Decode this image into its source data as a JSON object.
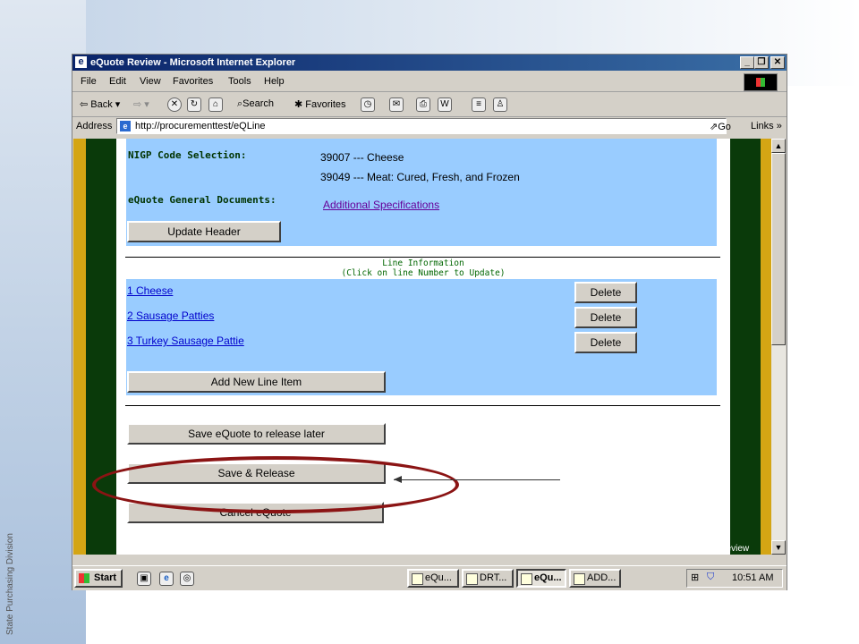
{
  "window": {
    "title": "eQuote Review - Microsoft Internet Explorer"
  },
  "menu": [
    "File",
    "Edit",
    "View",
    "Favorites",
    "Tools",
    "Help"
  ],
  "toolbar": {
    "back": "Back",
    "search": "Search",
    "favorites": "Favorites"
  },
  "address": {
    "label": "Address",
    "url": "http://procurementtest/eQLine",
    "go": "Go",
    "links": "Links"
  },
  "header": {
    "nigp_label": "NIGP Code Selection:",
    "nigp_codes": [
      "39007 --- Cheese",
      "39049 --- Meat: Cured, Fresh, and Frozen"
    ],
    "docs_label": "eQuote General Documents:",
    "docs_link": "Additional Specifications",
    "update_button": "Update Header"
  },
  "line_info": {
    "title": "Line Information",
    "hint": "(Click on line Number to Update)"
  },
  "line_items": [
    {
      "label": "1 Cheese",
      "delete": "Delete"
    },
    {
      "label": "2 Sausage Patties",
      "delete": "Delete"
    },
    {
      "label": "3 Turkey Sausage Pattie",
      "delete": "Delete"
    }
  ],
  "add_line_button": "Add New Line Item",
  "actions": {
    "save_later": "Save eQuote to release later",
    "save_release": "Save & Release",
    "cancel": "Cancel eQuote"
  },
  "frame_label": "EQ review",
  "taskbar": {
    "start": "Start",
    "tasks": [
      {
        "label": "eQu...",
        "active": false
      },
      {
        "label": "DRT...",
        "active": false
      },
      {
        "label": "eQu...",
        "active": true
      },
      {
        "label": "ADD...",
        "active": false
      }
    ],
    "clock": "10:51 AM"
  },
  "slide": {
    "footer": "State Purchasing Division"
  },
  "colors": {
    "highlight_circle": "#8b1414",
    "panel_blue": "#99ccff",
    "frame_green": "#0a3a0a",
    "frame_gold": "#d4a514"
  }
}
